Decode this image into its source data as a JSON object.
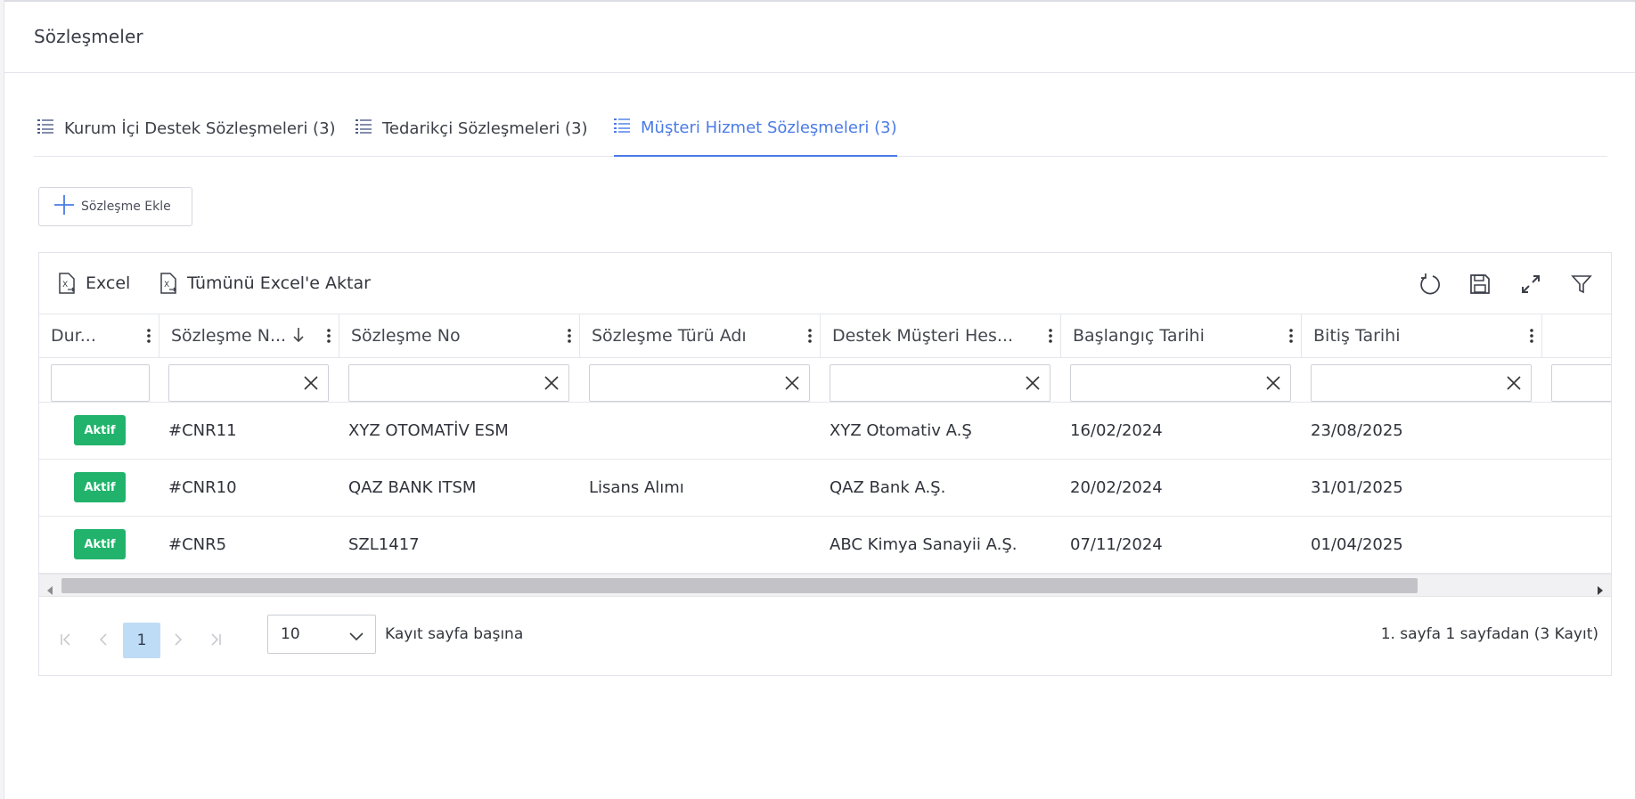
{
  "page": {
    "title": "Sözleşmeler"
  },
  "tabs": [
    {
      "label": "Kurum İçi Destek Sözleşmeleri (3)"
    },
    {
      "label": "Tedarikçi Sözleşmeleri (3)"
    },
    {
      "label": "Müşteri Hizmet Sözleşmeleri (3)",
      "active": true
    }
  ],
  "actions": {
    "add_label": "Sözleşme Ekle"
  },
  "toolbar": {
    "excel_label": "Excel",
    "excel_all_label": "Tümünü Excel'e Aktar",
    "icons": [
      "refresh-icon",
      "save-icon",
      "expand-icon",
      "filter-icon"
    ]
  },
  "columns": [
    "Dur...",
    "Sözleşme N...",
    "Sözleşme No",
    "Sözleşme Türü Adı",
    "Destek Müşteri Hes...",
    "Başlangıç Tarihi",
    "Bitiş Tarihi"
  ],
  "rows": [
    {
      "status": "Aktif",
      "id": "#CNR11",
      "no": "XYZ OTOMATİV ESM",
      "type": "",
      "customer": "XYZ Otomativ A.Ş",
      "start": "16/02/2024",
      "end": "23/08/2025"
    },
    {
      "status": "Aktif",
      "id": "#CNR10",
      "no": "QAZ BANK ITSM",
      "type": "Lisans Alımı",
      "customer": "QAZ Bank A.Ş.",
      "start": "20/02/2024",
      "end": "31/01/2025"
    },
    {
      "status": "Aktif",
      "id": "#CNR5",
      "no": "SZL1417",
      "type": "",
      "customer": "ABC Kimya Sanayii A.Ş.",
      "start": "07/11/2024",
      "end": "01/04/2025"
    }
  ],
  "pager": {
    "current_page": "1",
    "page_size": "10",
    "page_size_label": "Kayıt sayfa başına",
    "info": "1. sayfa 1 sayfadan (3 Kayıt)"
  },
  "colors": {
    "accent": "#4a7be6",
    "status_active": "#21b36b",
    "page_selected": "#bfdcf6"
  }
}
